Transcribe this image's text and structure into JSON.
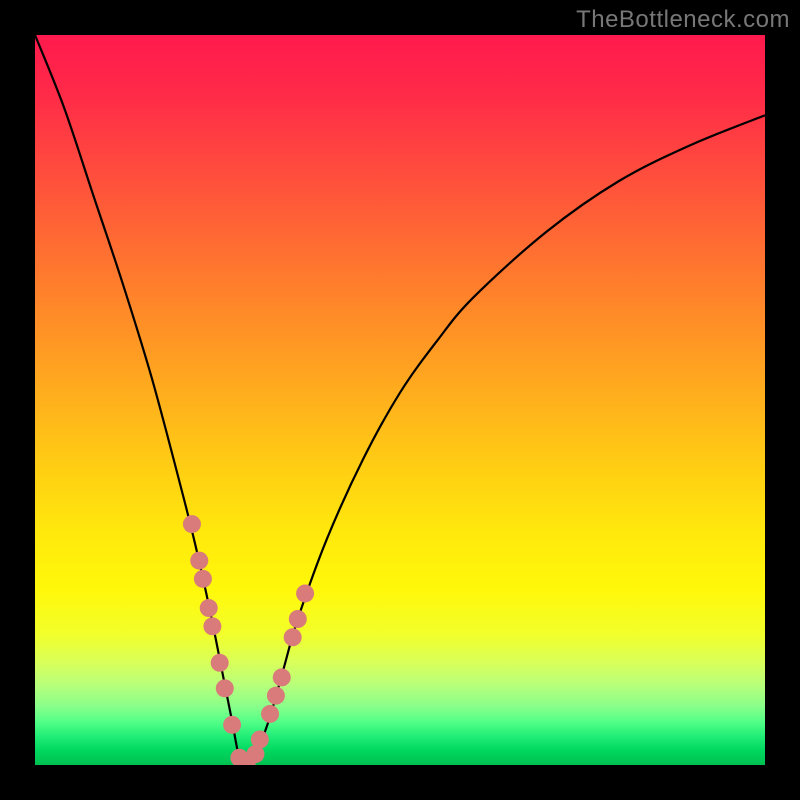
{
  "watermark": "TheBottleneck.com",
  "colors": {
    "background": "#000000",
    "marker": "#d97b7b",
    "curve": "#000000"
  },
  "chart_data": {
    "type": "line",
    "title": "",
    "xlabel": "",
    "ylabel": "",
    "xlim": [
      0,
      100
    ],
    "ylim": [
      0,
      100
    ],
    "grid": false,
    "legend": false,
    "series": [
      {
        "name": "bottleneck-curve",
        "x": [
          0,
          4,
          8,
          12,
          16,
          20,
          22,
          24,
          26,
          27,
          28,
          29,
          30,
          32,
          34,
          36,
          40,
          45,
          50,
          55,
          60,
          70,
          80,
          90,
          100
        ],
        "values": [
          100,
          90,
          78,
          66,
          53,
          38,
          30,
          21,
          11,
          6,
          1,
          0,
          1,
          6,
          13,
          20,
          31,
          42,
          51,
          58,
          64,
          73,
          80,
          85,
          89
        ]
      }
    ],
    "markers": {
      "name": "highlighted-points",
      "x": [
        21.5,
        22.5,
        23.0,
        23.8,
        24.3,
        25.3,
        26.0,
        27.0,
        28.0,
        29.0,
        30.2,
        30.8,
        32.2,
        33.0,
        33.8,
        35.3,
        36.0,
        37.0
      ],
      "values": [
        33.0,
        28.0,
        25.5,
        21.5,
        19.0,
        14.0,
        10.5,
        5.5,
        1.0,
        0.0,
        1.5,
        3.5,
        7.0,
        9.5,
        12.0,
        17.5,
        20.0,
        23.5
      ]
    }
  }
}
